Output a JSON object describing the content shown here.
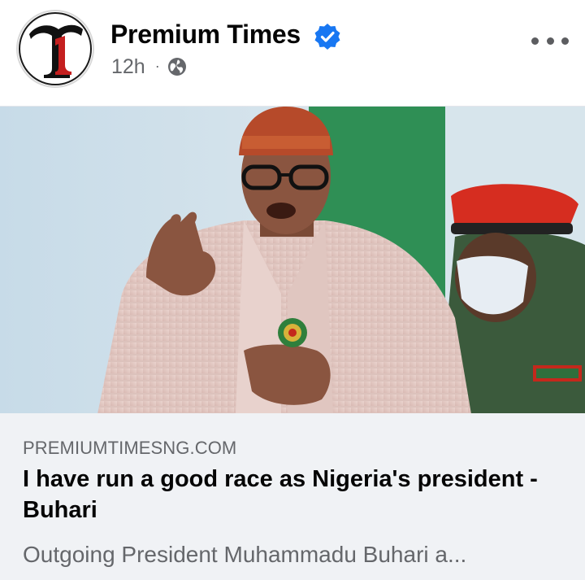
{
  "post": {
    "page_name": "Premium Times",
    "timestamp": "12h",
    "separator": "·",
    "audience_icon": "globe-icon",
    "verified_icon": "verified-badge-icon",
    "more_icon": "more-options-icon",
    "avatar_icon": "premium-times-logo-icon"
  },
  "link_preview": {
    "domain": "PREMIUMTIMESNG.COM",
    "headline": "I have run a good race as Nigeria's president - Buhari",
    "excerpt": "Outgoing President Muhammadu Buhari a..."
  },
  "colors": {
    "verified_blue": "#1877f2",
    "secondary_text": "#65676b",
    "preview_background": "#f0f2f5",
    "logo_red": "#c41f1f"
  }
}
